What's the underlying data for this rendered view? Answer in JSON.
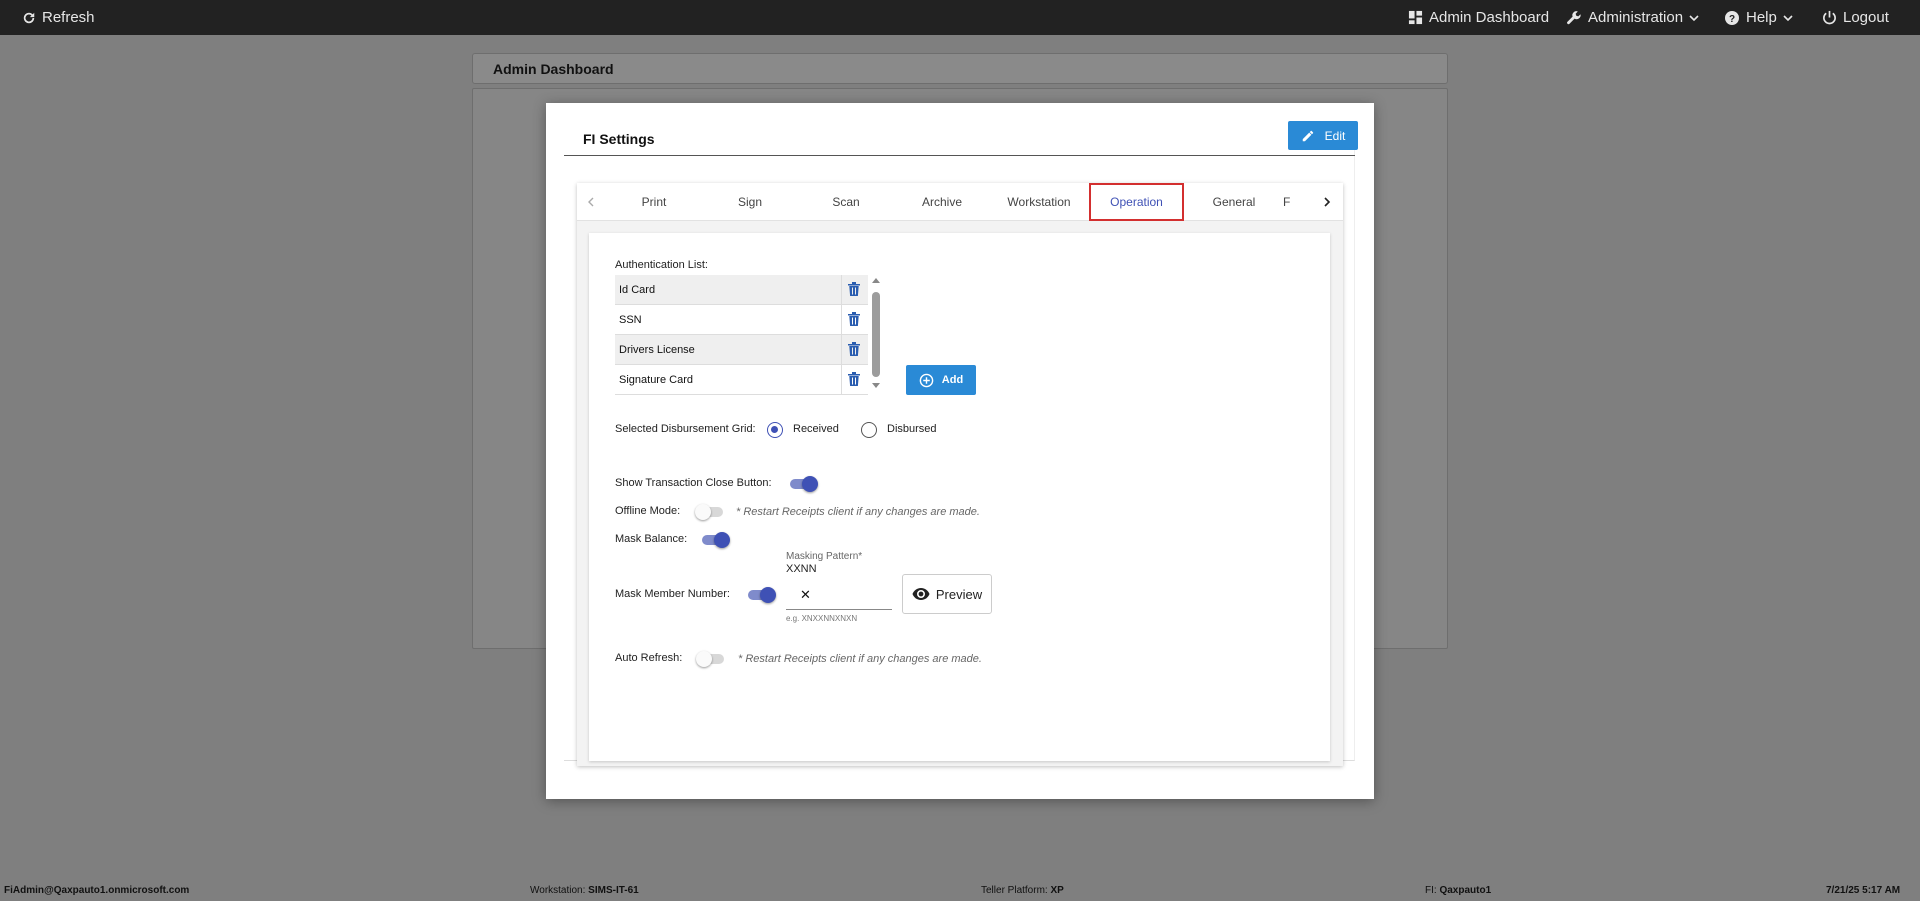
{
  "topbar": {
    "refresh_label": "Refresh",
    "admin_dashboard_label": "Admin Dashboard",
    "administration_label": "Administration",
    "help_label": "Help",
    "logout_label": "Logout"
  },
  "background": {
    "dashboard_title": "Admin Dashboard"
  },
  "modal": {
    "title": "FI Settings",
    "edit_label": "Edit",
    "tabs": [
      {
        "label": "Print"
      },
      {
        "label": "Sign"
      },
      {
        "label": "Scan"
      },
      {
        "label": "Archive"
      },
      {
        "label": "Workstation"
      },
      {
        "label": "Operation"
      },
      {
        "label": "General"
      },
      {
        "label": "F"
      }
    ],
    "active_tab": "Operation"
  },
  "operation": {
    "auth_list_label": "Authentication List:",
    "auth_items": [
      {
        "name": "Id Card"
      },
      {
        "name": "SSN"
      },
      {
        "name": "Drivers License"
      },
      {
        "name": "Signature Card"
      }
    ],
    "add_label": "Add",
    "disbursement_label": "Selected Disbursement Grid:",
    "disbursement_options": [
      {
        "label": "Received",
        "selected": true
      },
      {
        "label": "Disbursed",
        "selected": false
      }
    ],
    "show_close_label": "Show Transaction Close Button:",
    "show_close_on": true,
    "offline_label": "Offline Mode:",
    "offline_on": false,
    "restart_note": "* Restart Receipts client if any changes are made.",
    "mask_balance_label": "Mask Balance:",
    "mask_balance_on": true,
    "mask_member_label": "Mask Member Number:",
    "mask_member_on": true,
    "masking_pattern_label": "Masking Pattern*",
    "masking_pattern_value": "XXNN",
    "clear_symbol": "✕",
    "masking_hint": "e.g. XNXXNNXNXN",
    "preview_label": "Preview",
    "auto_refresh_label": "Auto Refresh:",
    "auto_refresh_on": false
  },
  "statusbar": {
    "user": "FiAdmin@Qaxpauto1.onmicrosoft.com",
    "workstation_label": "Workstation:",
    "workstation_value": "SIMS-IT-61",
    "teller_label": "Teller Platform:",
    "teller_value": "XP",
    "fi_label": "FI:",
    "fi_value": "Qaxpauto1",
    "datetime": "7/21/25 5:17 AM"
  },
  "colors": {
    "accent_blue": "#2a8ad6",
    "toggle_blue": "#3f51b5",
    "active_tab_border": "#d32f2f",
    "topbar": "#222222"
  },
  "icons": [
    "refresh-icon",
    "dashboard-icon",
    "wrench-icon",
    "help-icon",
    "power-icon",
    "pencil-icon",
    "trash-icon",
    "add-circle-icon",
    "eye-icon",
    "chevron-left-icon",
    "chevron-right-icon",
    "chevron-down-icon"
  ]
}
